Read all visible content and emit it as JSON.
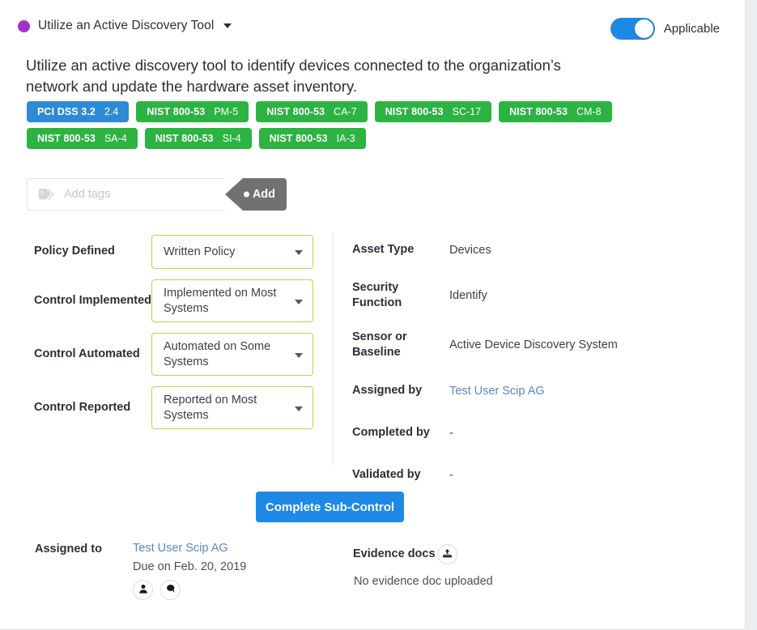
{
  "header": {
    "status_dot_color": "#a530c9",
    "title": "Utilize an Active Discovery Tool",
    "caret_icon": "chevron-down-icon",
    "toggle": {
      "state": "on",
      "label": "Applicable",
      "color": "#1e88e5"
    }
  },
  "description": "Utilize an active discovery tool to identify devices connected to the organization’s network and update the hardware asset inventory.",
  "badges": [
    {
      "framework": "PCI DSS 3.2",
      "code": "2.4",
      "color": "#2d8ad6"
    },
    {
      "framework": "NIST 800-53",
      "code": "PM-5",
      "color": "#2cb342"
    },
    {
      "framework": "NIST 800-53",
      "code": "CA-7",
      "color": "#2cb342"
    },
    {
      "framework": "NIST 800-53",
      "code": "SC-17",
      "color": "#2cb342"
    },
    {
      "framework": "NIST 800-53",
      "code": "CM-8",
      "color": "#2cb342"
    },
    {
      "framework": "NIST 800-53",
      "code": "SA-4",
      "color": "#2cb342"
    },
    {
      "framework": "NIST 800-53",
      "code": "SI-4",
      "color": "#2cb342"
    },
    {
      "framework": "NIST 800-53",
      "code": "IA-3",
      "color": "#2cb342"
    }
  ],
  "tags": {
    "icon": "tag-icon",
    "input_value": "",
    "placeholder": "Add tags",
    "add_label": "Add"
  },
  "form": {
    "border_color": "#cfc84f",
    "rows": [
      {
        "label": "Policy Defined",
        "value": "Written Policy"
      },
      {
        "label": "Control Implemented",
        "value": "Implemented on Most Systems"
      },
      {
        "label": "Control Automated",
        "value": "Automated on Some Systems"
      },
      {
        "label": "Control Reported",
        "value": "Reported on Most Systems"
      }
    ]
  },
  "details": [
    {
      "label": "Asset Type",
      "value": "Devices",
      "is_link": false
    },
    {
      "label": "Security Function",
      "value": "Identify",
      "is_link": false
    },
    {
      "label": "Sensor or Baseline",
      "value": "Active Device Discovery System",
      "is_link": false
    },
    {
      "label": "Assigned by",
      "value": "Test User Scip AG",
      "is_link": true
    },
    {
      "label": "Completed by",
      "value": "-",
      "is_link": false
    },
    {
      "label": "Validated by",
      "value": "-",
      "is_link": false
    }
  ],
  "complete_button": {
    "label": "Complete Sub-Control",
    "color": "#1e88e5"
  },
  "footer": {
    "assigned_to_label": "Assigned to",
    "assignee_name": "Test User Scip AG",
    "due_date": "Due on Feb. 20, 2019",
    "person_icon": "person-icon",
    "comment_icon": "comment-icon",
    "evidence_label": "Evidence docs",
    "upload_icon": "upload-icon",
    "evidence_status": "No evidence doc uploaded"
  }
}
